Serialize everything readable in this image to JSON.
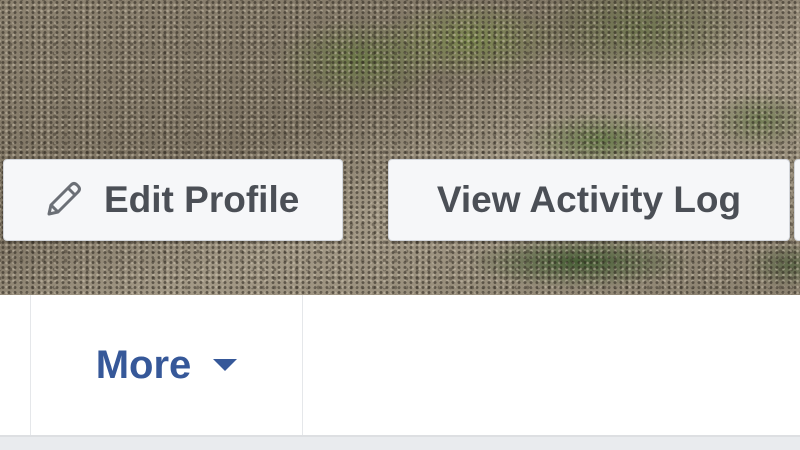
{
  "cover": {
    "photo_description_icon": "cover-photo"
  },
  "actions": {
    "edit_profile_label": "Edit Profile",
    "edit_profile_icon": "pencil-icon",
    "activity_log_label": "View Activity Log"
  },
  "nav": {
    "more_label": "More",
    "more_icon": "caret-down-icon"
  },
  "colors": {
    "link_blue": "#365899",
    "button_text": "#4b4f56",
    "button_bg": "#f6f7f9",
    "border": "#d3d6db",
    "page_bg": "#e9ebee"
  }
}
